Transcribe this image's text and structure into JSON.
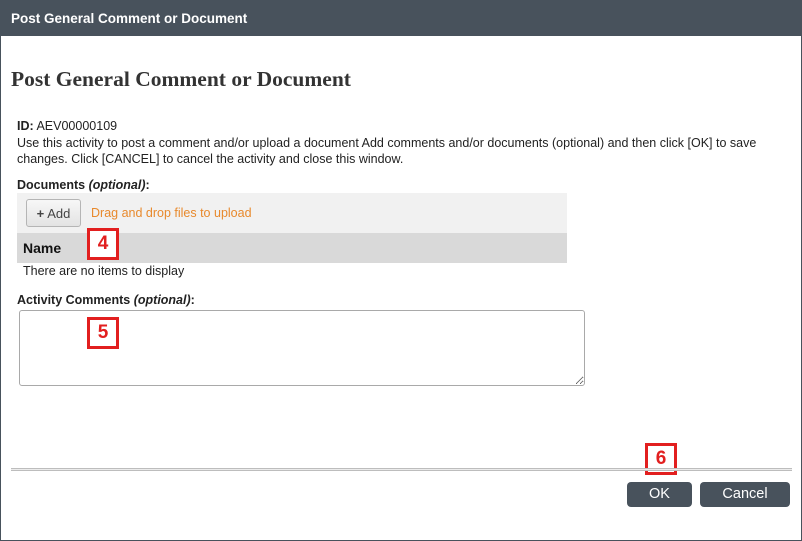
{
  "window": {
    "title": "Post General Comment or Document"
  },
  "page": {
    "heading": "Post General Comment or Document"
  },
  "record": {
    "id_label": "ID:",
    "id_value": "AEV00000109"
  },
  "instructions": "Use this activity to post a comment and/or upload a document Add comments and/or documents (optional) and then click [OK] to save changes. Click [CANCEL] to cancel the activity and close this window.",
  "documents": {
    "label": "Documents",
    "optional_label": "(optional)",
    "label_suffix": ":",
    "add_button": {
      "icon": "plus-icon",
      "icon_glyph": "+",
      "label": "Add"
    },
    "drop_hint": "Drag and drop files to upload",
    "columns": [
      "Name"
    ],
    "empty_text": "There are no items to display"
  },
  "comments": {
    "label": "Activity Comments",
    "optional_label": "(optional)",
    "label_suffix": ":",
    "value": ""
  },
  "callouts": [
    "4",
    "5",
    "6"
  ],
  "footer": {
    "ok_label": "OK",
    "cancel_label": "Cancel"
  },
  "colors": {
    "header": "#48525c",
    "accent_orange": "#e8892c",
    "callout_red": "#e21f1f"
  }
}
